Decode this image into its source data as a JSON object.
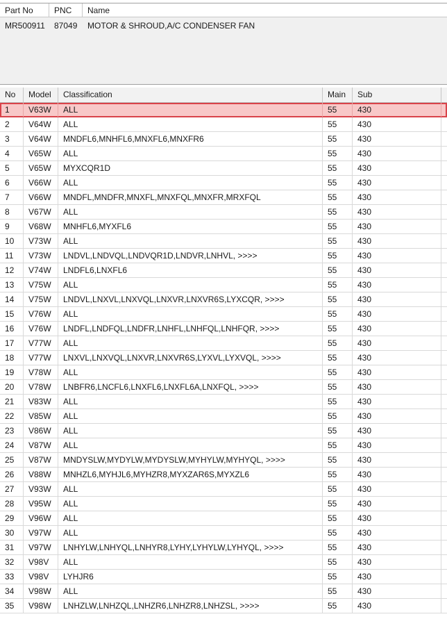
{
  "part_panel": {
    "headers": {
      "part_no": "Part No",
      "pnc": "PNC",
      "name": "Name"
    },
    "row": {
      "part_no": "MR500911",
      "pnc": "87049",
      "name": "MOTOR & SHROUD,A/C CONDENSER FAN"
    }
  },
  "grid": {
    "headers": {
      "no": "No",
      "model": "Model",
      "classification": "Classification",
      "main": "Main",
      "sub": "Sub"
    },
    "selected_row": 1,
    "selection_color": "#d9434a",
    "rows": [
      {
        "no": "1",
        "model": "V63W",
        "classification": "ALL",
        "main": "55",
        "sub": "430"
      },
      {
        "no": "2",
        "model": "V64W",
        "classification": "ALL",
        "main": "55",
        "sub": "430"
      },
      {
        "no": "3",
        "model": "V64W",
        "classification": "MNDFL6,MNHFL6,MNXFL6,MNXFR6",
        "main": "55",
        "sub": "430"
      },
      {
        "no": "4",
        "model": "V65W",
        "classification": "ALL",
        "main": "55",
        "sub": "430"
      },
      {
        "no": "5",
        "model": "V65W",
        "classification": "MYXCQR1D",
        "main": "55",
        "sub": "430"
      },
      {
        "no": "6",
        "model": "V66W",
        "classification": "ALL",
        "main": "55",
        "sub": "430"
      },
      {
        "no": "7",
        "model": "V66W",
        "classification": "MNDFL,MNDFR,MNXFL,MNXFQL,MNXFR,MRXFQL",
        "main": "55",
        "sub": "430"
      },
      {
        "no": "8",
        "model": "V67W",
        "classification": "ALL",
        "main": "55",
        "sub": "430"
      },
      {
        "no": "9",
        "model": "V68W",
        "classification": "MNHFL6,MYXFL6",
        "main": "55",
        "sub": "430"
      },
      {
        "no": "10",
        "model": "V73W",
        "classification": "ALL",
        "main": "55",
        "sub": "430"
      },
      {
        "no": "11",
        "model": "V73W",
        "classification": "LNDVL,LNDVQL,LNDVQR1D,LNDVR,LNHVL,  >>>>",
        "main": "55",
        "sub": "430"
      },
      {
        "no": "12",
        "model": "V74W",
        "classification": "LNDFL6,LNXFL6",
        "main": "55",
        "sub": "430"
      },
      {
        "no": "13",
        "model": "V75W",
        "classification": "ALL",
        "main": "55",
        "sub": "430"
      },
      {
        "no": "14",
        "model": "V75W",
        "classification": "LNDVL,LNXVL,LNXVQL,LNXVR,LNXVR6S,LYXCQR,  >>>>",
        "main": "55",
        "sub": "430"
      },
      {
        "no": "15",
        "model": "V76W",
        "classification": "ALL",
        "main": "55",
        "sub": "430"
      },
      {
        "no": "16",
        "model": "V76W",
        "classification": "LNDFL,LNDFQL,LNDFR,LNHFL,LNHFQL,LNHFQR,  >>>>",
        "main": "55",
        "sub": "430"
      },
      {
        "no": "17",
        "model": "V77W",
        "classification": "ALL",
        "main": "55",
        "sub": "430"
      },
      {
        "no": "18",
        "model": "V77W",
        "classification": "LNXVL,LNXVQL,LNXVR,LNXVR6S,LYXVL,LYXVQL,  >>>>",
        "main": "55",
        "sub": "430"
      },
      {
        "no": "19",
        "model": "V78W",
        "classification": "ALL",
        "main": "55",
        "sub": "430"
      },
      {
        "no": "20",
        "model": "V78W",
        "classification": "LNBFR6,LNCFL6,LNXFL6,LNXFL6A,LNXFQL,  >>>>",
        "main": "55",
        "sub": "430"
      },
      {
        "no": "21",
        "model": "V83W",
        "classification": "ALL",
        "main": "55",
        "sub": "430"
      },
      {
        "no": "22",
        "model": "V85W",
        "classification": "ALL",
        "main": "55",
        "sub": "430"
      },
      {
        "no": "23",
        "model": "V86W",
        "classification": "ALL",
        "main": "55",
        "sub": "430"
      },
      {
        "no": "24",
        "model": "V87W",
        "classification": "ALL",
        "main": "55",
        "sub": "430"
      },
      {
        "no": "25",
        "model": "V87W",
        "classification": "MNDYSLW,MYDYLW,MYDYSLW,MYHYLW,MYHYQL,  >>>>",
        "main": "55",
        "sub": "430"
      },
      {
        "no": "26",
        "model": "V88W",
        "classification": "MNHZL6,MYHJL6,MYHZR8,MYXZAR6S,MYXZL6",
        "main": "55",
        "sub": "430"
      },
      {
        "no": "27",
        "model": "V93W",
        "classification": "ALL",
        "main": "55",
        "sub": "430"
      },
      {
        "no": "28",
        "model": "V95W",
        "classification": "ALL",
        "main": "55",
        "sub": "430"
      },
      {
        "no": "29",
        "model": "V96W",
        "classification": "ALL",
        "main": "55",
        "sub": "430"
      },
      {
        "no": "30",
        "model": "V97W",
        "classification": "ALL",
        "main": "55",
        "sub": "430"
      },
      {
        "no": "31",
        "model": "V97W",
        "classification": "LNHYLW,LNHYQL,LNHYR8,LYHY,LYHYLW,LYHYQL,  >>>>",
        "main": "55",
        "sub": "430"
      },
      {
        "no": "32",
        "model": "V98V",
        "classification": "ALL",
        "main": "55",
        "sub": "430"
      },
      {
        "no": "33",
        "model": "V98V",
        "classification": "LYHJR6",
        "main": "55",
        "sub": "430"
      },
      {
        "no": "34",
        "model": "V98W",
        "classification": "ALL",
        "main": "55",
        "sub": "430"
      },
      {
        "no": "35",
        "model": "V98W",
        "classification": "LNHZLW,LNHZQL,LNHZR6,LNHZR8,LNHZSL,  >>>>",
        "main": "55",
        "sub": "430"
      }
    ]
  }
}
